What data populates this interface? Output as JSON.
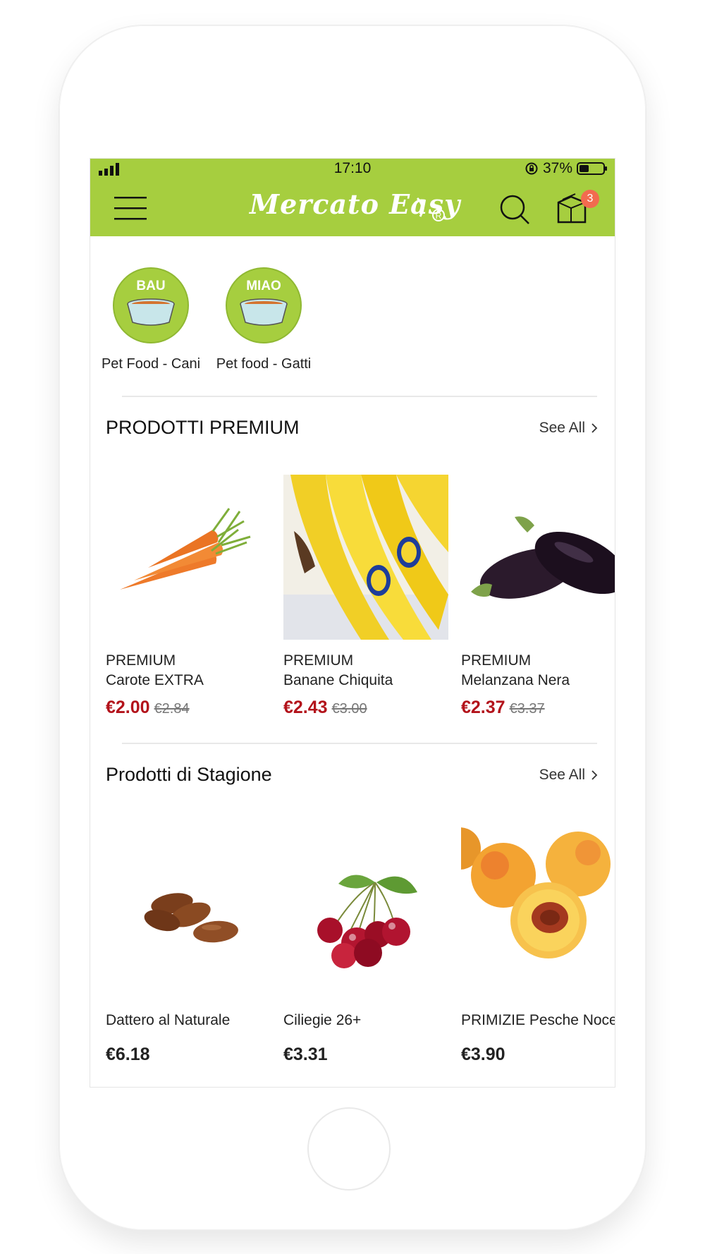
{
  "status": {
    "time": "17:10",
    "battery": "37%"
  },
  "header": {
    "logo": "Mercato Easy",
    "cart_count": "3"
  },
  "colors": {
    "brand_green": "#a6ce3f",
    "price_red": "#b3131b",
    "badge": "#f26b4f"
  },
  "categories": [
    {
      "badge": "BAU",
      "label": "Pet Food - Cani",
      "icon": "dog-bowl-icon"
    },
    {
      "badge": "MIAO",
      "label": "Pet food - Gatti",
      "icon": "cat-bowl-icon"
    }
  ],
  "sections": [
    {
      "title": "PRODOTTI PREMIUM",
      "see_all": "See All",
      "products": [
        {
          "line1": "PREMIUM",
          "line2": "Carote EXTRA",
          "price": "€2.00",
          "old_price": "€2.84",
          "image": "carrots"
        },
        {
          "line1": "PREMIUM",
          "line2": "Banane Chiquita",
          "price": "€2.43",
          "old_price": "€3.00",
          "image": "bananas"
        },
        {
          "line1": "PREMIUM",
          "line2": "Melanzana Nera",
          "price": "€2.37",
          "old_price": "€3.37",
          "image": "eggplants"
        }
      ]
    },
    {
      "title": "Prodotti di Stagione",
      "see_all": "See All",
      "products": [
        {
          "name": "Dattero al Naturale",
          "price": "€6.18",
          "image": "dates"
        },
        {
          "name": "Ciliegie 26+",
          "price": "€3.31",
          "image": "cherries"
        },
        {
          "name": "PRIMIZIE Pesche Noce",
          "price": "€3.90",
          "image": "peaches"
        }
      ]
    }
  ]
}
